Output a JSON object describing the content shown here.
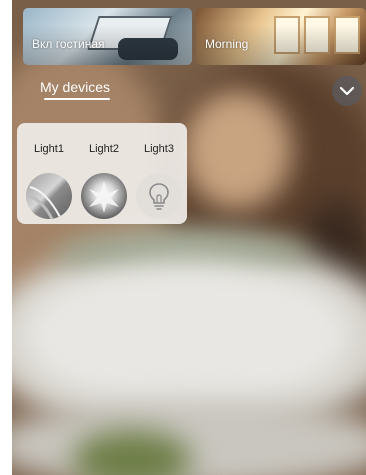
{
  "scenes": [
    {
      "label": "Вкл гостиная"
    },
    {
      "label": "Morning"
    }
  ],
  "section": {
    "title": "My devices"
  },
  "devices": [
    {
      "name": "Light1"
    },
    {
      "name": "Light2"
    },
    {
      "name": "Light3"
    }
  ],
  "icons": {
    "collapse": "chevron-down-icon",
    "light3": "lightbulb-icon"
  },
  "colors": {
    "panel_bg": "#f0ede9",
    "text_light": "#ffffff",
    "text_dark": "#222222",
    "collapse_bg": "#5a5a5f"
  }
}
